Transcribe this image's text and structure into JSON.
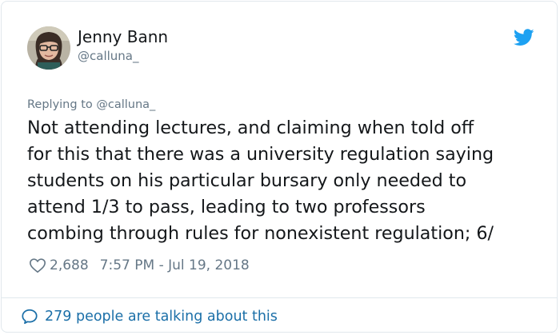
{
  "author": {
    "name": "Jenny Bann",
    "handle": "@calluna_"
  },
  "reply": {
    "text": "Replying to @calluna_"
  },
  "tweet": {
    "lines": [
      "Not attending lectures, and claiming when told off",
      "for this that there was a university regulation saying",
      "students on his particular bursary only needed to",
      "attend 1/3 to pass, leading to two professors",
      "combing through rules for nonexistent regulation; 6/"
    ]
  },
  "meta": {
    "likes": "2,688",
    "timestamp": "7:57 PM - Jul 19, 2018"
  },
  "footer": {
    "talking": "279 people are talking about this"
  },
  "icons": {
    "brand": "twitter-bird-icon",
    "like": "heart-icon",
    "comments": "speech-bubble-icon"
  },
  "colors": {
    "brand": "#1da1f2",
    "link": "#1b6fa8",
    "text": "#14171a",
    "muted": "#657786",
    "border": "#e1e8ed"
  }
}
